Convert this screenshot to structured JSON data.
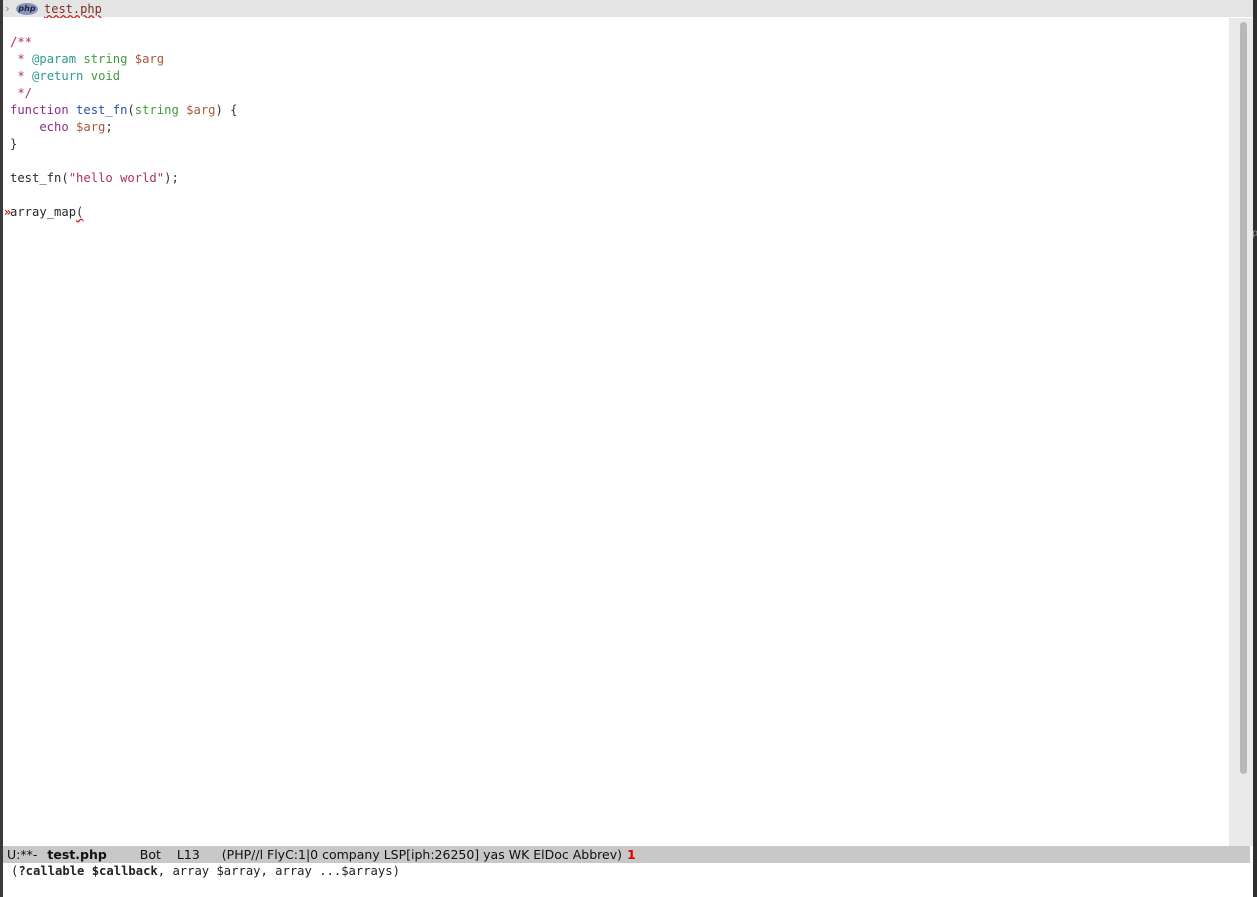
{
  "header_line": {
    "fringe_arrow": "›",
    "php_logo": "php",
    "file_name": "test.php"
  },
  "code_lines": {
    "l1": "/**",
    "l2_star": " * ",
    "l2_tag": "@param",
    "l2_type": " string ",
    "l2_var": "$arg",
    "l3_star": " * ",
    "l3_tag": "@return",
    "l3_type": " void",
    "l4": " */",
    "l5_kw": "function",
    "l5_fn": "test_fn",
    "l5_paren": "(",
    "l5_type": "string",
    "l5_var": "$arg",
    "l5_rest": ") {",
    "l6_kw": "    echo",
    "l6_var": "$arg",
    "l6_rest": ";",
    "l7": "}",
    "l9_fn": "test_fn",
    "l9_open": "(",
    "l9_str": "\"hello world\"",
    "l9_close": ");",
    "l11_fn": "array_map",
    "l11_paren": "("
  },
  "fringe_marker": "»",
  "mode_line": {
    "status": "U:**-",
    "buffer": "test.php",
    "position": "Bot",
    "line": "L13",
    "modes": "(PHP//l FlyC:1|0 company LSP[iph:26250] yas WK ElDoc Abbrev)",
    "error_count": "1"
  },
  "echo_area": {
    "open": "(",
    "bold": "?callable $callback",
    "rest": ", array $array, array ...$arrays)"
  },
  "right_glyph": "p"
}
